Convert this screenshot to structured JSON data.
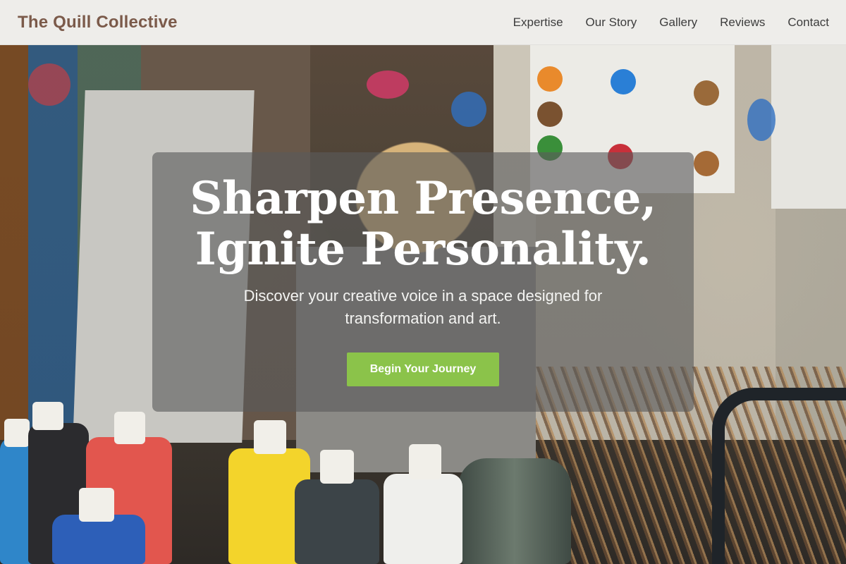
{
  "header": {
    "brand": "The Quill Collective",
    "nav": [
      {
        "label": "Expertise"
      },
      {
        "label": "Our Story"
      },
      {
        "label": "Gallery"
      },
      {
        "label": "Reviews"
      },
      {
        "label": "Contact"
      }
    ]
  },
  "hero": {
    "title_line1": "Sharpen Presence,",
    "title_line2": "Ignite Personality.",
    "subtitle": "Discover your creative voice in a space designed for transformation and art.",
    "cta_label": "Begin Your Journey",
    "background_image": "art-studio-paints-photo"
  },
  "colors": {
    "brand_text": "#7b5a4a",
    "nav_text": "#3d3d3d",
    "cta_bg": "#8bc34a",
    "card_overlay": "rgba(90,90,90,0.62)"
  }
}
